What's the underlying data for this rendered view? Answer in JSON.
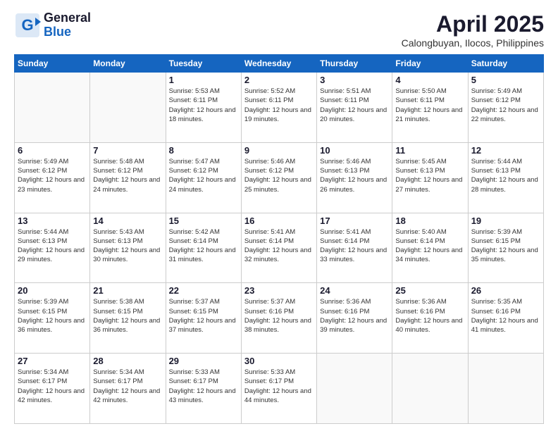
{
  "logo": {
    "general": "General",
    "blue": "Blue"
  },
  "header": {
    "month": "April 2025",
    "location": "Calongbuyan, Ilocos, Philippines"
  },
  "days_of_week": [
    "Sunday",
    "Monday",
    "Tuesday",
    "Wednesday",
    "Thursday",
    "Friday",
    "Saturday"
  ],
  "weeks": [
    [
      {
        "day": "",
        "sunrise": "",
        "sunset": "",
        "daylight": ""
      },
      {
        "day": "",
        "sunrise": "",
        "sunset": "",
        "daylight": ""
      },
      {
        "day": "1",
        "sunrise": "Sunrise: 5:53 AM",
        "sunset": "Sunset: 6:11 PM",
        "daylight": "Daylight: 12 hours and 18 minutes."
      },
      {
        "day": "2",
        "sunrise": "Sunrise: 5:52 AM",
        "sunset": "Sunset: 6:11 PM",
        "daylight": "Daylight: 12 hours and 19 minutes."
      },
      {
        "day": "3",
        "sunrise": "Sunrise: 5:51 AM",
        "sunset": "Sunset: 6:11 PM",
        "daylight": "Daylight: 12 hours and 20 minutes."
      },
      {
        "day": "4",
        "sunrise": "Sunrise: 5:50 AM",
        "sunset": "Sunset: 6:11 PM",
        "daylight": "Daylight: 12 hours and 21 minutes."
      },
      {
        "day": "5",
        "sunrise": "Sunrise: 5:49 AM",
        "sunset": "Sunset: 6:12 PM",
        "daylight": "Daylight: 12 hours and 22 minutes."
      }
    ],
    [
      {
        "day": "6",
        "sunrise": "Sunrise: 5:49 AM",
        "sunset": "Sunset: 6:12 PM",
        "daylight": "Daylight: 12 hours and 23 minutes."
      },
      {
        "day": "7",
        "sunrise": "Sunrise: 5:48 AM",
        "sunset": "Sunset: 6:12 PM",
        "daylight": "Daylight: 12 hours and 24 minutes."
      },
      {
        "day": "8",
        "sunrise": "Sunrise: 5:47 AM",
        "sunset": "Sunset: 6:12 PM",
        "daylight": "Daylight: 12 hours and 24 minutes."
      },
      {
        "day": "9",
        "sunrise": "Sunrise: 5:46 AM",
        "sunset": "Sunset: 6:12 PM",
        "daylight": "Daylight: 12 hours and 25 minutes."
      },
      {
        "day": "10",
        "sunrise": "Sunrise: 5:46 AM",
        "sunset": "Sunset: 6:13 PM",
        "daylight": "Daylight: 12 hours and 26 minutes."
      },
      {
        "day": "11",
        "sunrise": "Sunrise: 5:45 AM",
        "sunset": "Sunset: 6:13 PM",
        "daylight": "Daylight: 12 hours and 27 minutes."
      },
      {
        "day": "12",
        "sunrise": "Sunrise: 5:44 AM",
        "sunset": "Sunset: 6:13 PM",
        "daylight": "Daylight: 12 hours and 28 minutes."
      }
    ],
    [
      {
        "day": "13",
        "sunrise": "Sunrise: 5:44 AM",
        "sunset": "Sunset: 6:13 PM",
        "daylight": "Daylight: 12 hours and 29 minutes."
      },
      {
        "day": "14",
        "sunrise": "Sunrise: 5:43 AM",
        "sunset": "Sunset: 6:13 PM",
        "daylight": "Daylight: 12 hours and 30 minutes."
      },
      {
        "day": "15",
        "sunrise": "Sunrise: 5:42 AM",
        "sunset": "Sunset: 6:14 PM",
        "daylight": "Daylight: 12 hours and 31 minutes."
      },
      {
        "day": "16",
        "sunrise": "Sunrise: 5:41 AM",
        "sunset": "Sunset: 6:14 PM",
        "daylight": "Daylight: 12 hours and 32 minutes."
      },
      {
        "day": "17",
        "sunrise": "Sunrise: 5:41 AM",
        "sunset": "Sunset: 6:14 PM",
        "daylight": "Daylight: 12 hours and 33 minutes."
      },
      {
        "day": "18",
        "sunrise": "Sunrise: 5:40 AM",
        "sunset": "Sunset: 6:14 PM",
        "daylight": "Daylight: 12 hours and 34 minutes."
      },
      {
        "day": "19",
        "sunrise": "Sunrise: 5:39 AM",
        "sunset": "Sunset: 6:15 PM",
        "daylight": "Daylight: 12 hours and 35 minutes."
      }
    ],
    [
      {
        "day": "20",
        "sunrise": "Sunrise: 5:39 AM",
        "sunset": "Sunset: 6:15 PM",
        "daylight": "Daylight: 12 hours and 36 minutes."
      },
      {
        "day": "21",
        "sunrise": "Sunrise: 5:38 AM",
        "sunset": "Sunset: 6:15 PM",
        "daylight": "Daylight: 12 hours and 36 minutes."
      },
      {
        "day": "22",
        "sunrise": "Sunrise: 5:37 AM",
        "sunset": "Sunset: 6:15 PM",
        "daylight": "Daylight: 12 hours and 37 minutes."
      },
      {
        "day": "23",
        "sunrise": "Sunrise: 5:37 AM",
        "sunset": "Sunset: 6:16 PM",
        "daylight": "Daylight: 12 hours and 38 minutes."
      },
      {
        "day": "24",
        "sunrise": "Sunrise: 5:36 AM",
        "sunset": "Sunset: 6:16 PM",
        "daylight": "Daylight: 12 hours and 39 minutes."
      },
      {
        "day": "25",
        "sunrise": "Sunrise: 5:36 AM",
        "sunset": "Sunset: 6:16 PM",
        "daylight": "Daylight: 12 hours and 40 minutes."
      },
      {
        "day": "26",
        "sunrise": "Sunrise: 5:35 AM",
        "sunset": "Sunset: 6:16 PM",
        "daylight": "Daylight: 12 hours and 41 minutes."
      }
    ],
    [
      {
        "day": "27",
        "sunrise": "Sunrise: 5:34 AM",
        "sunset": "Sunset: 6:17 PM",
        "daylight": "Daylight: 12 hours and 42 minutes."
      },
      {
        "day": "28",
        "sunrise": "Sunrise: 5:34 AM",
        "sunset": "Sunset: 6:17 PM",
        "daylight": "Daylight: 12 hours and 42 minutes."
      },
      {
        "day": "29",
        "sunrise": "Sunrise: 5:33 AM",
        "sunset": "Sunset: 6:17 PM",
        "daylight": "Daylight: 12 hours and 43 minutes."
      },
      {
        "day": "30",
        "sunrise": "Sunrise: 5:33 AM",
        "sunset": "Sunset: 6:17 PM",
        "daylight": "Daylight: 12 hours and 44 minutes."
      },
      {
        "day": "",
        "sunrise": "",
        "sunset": "",
        "daylight": ""
      },
      {
        "day": "",
        "sunrise": "",
        "sunset": "",
        "daylight": ""
      },
      {
        "day": "",
        "sunrise": "",
        "sunset": "",
        "daylight": ""
      }
    ]
  ]
}
